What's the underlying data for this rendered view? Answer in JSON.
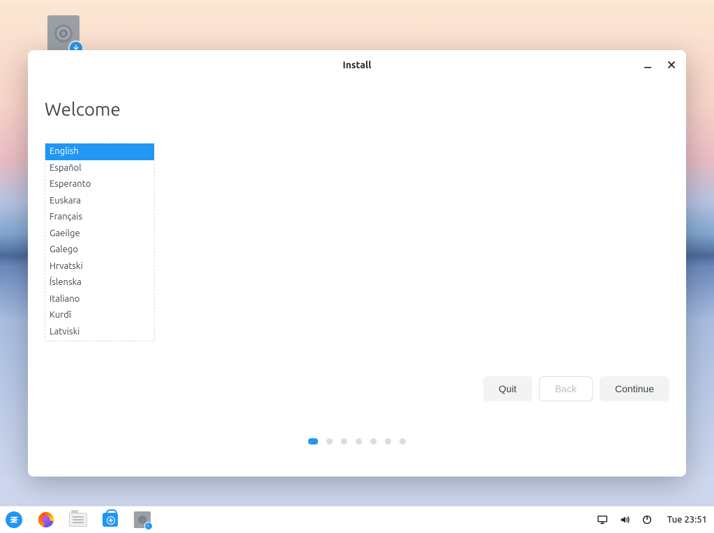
{
  "window": {
    "title": "Install",
    "heading": "Welcome",
    "languages": [
      "English",
      "Español",
      "Esperanto",
      "Euskara",
      "Français",
      "Gaeilge",
      "Galego",
      "Hrvatski",
      "Íslenska",
      "Italiano",
      "Kurdî",
      "Latviski"
    ],
    "selected_index": 0,
    "buttons": {
      "quit": "Quit",
      "back": "Back",
      "continue": "Continue"
    },
    "step_count": 7,
    "active_step": 0
  },
  "taskbar": {
    "clock": "Tue 23:51"
  },
  "desktop_icon": {
    "name": "installer"
  }
}
